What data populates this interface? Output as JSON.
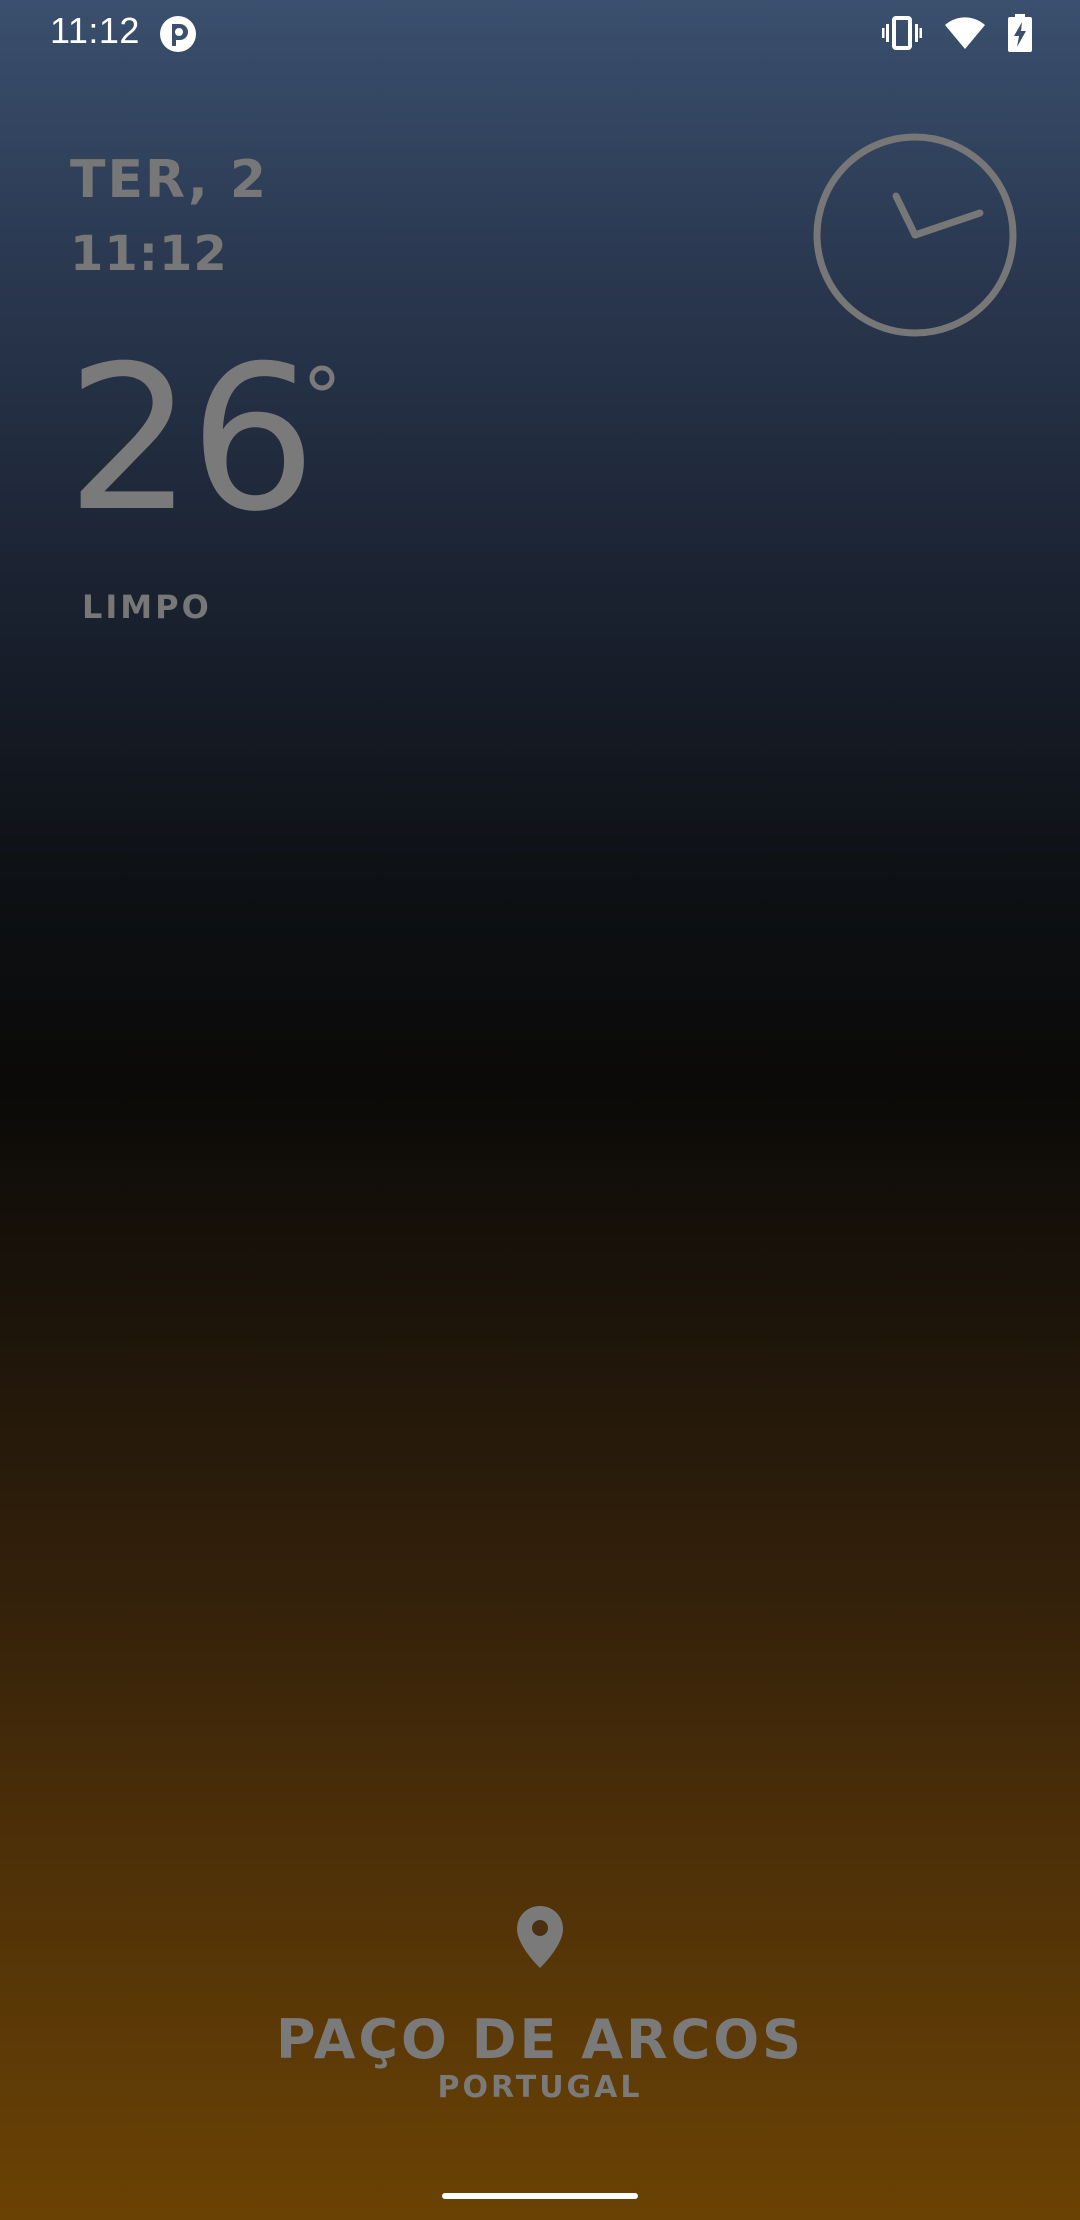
{
  "status_bar": {
    "time": "11:12",
    "app_icon": "app-notification-icon",
    "icons": [
      "vibrate-icon",
      "wifi-icon",
      "battery-charging-icon"
    ]
  },
  "widget": {
    "date": "TER, 2",
    "time": "11:12",
    "temperature": "26",
    "condition": "LIMPO",
    "clock_icon": "analog-clock-icon"
  },
  "location": {
    "pin_icon": "location-pin-icon",
    "city": "PAÇO DE ARCOS",
    "country": "PORTUGAL"
  },
  "colors": {
    "text": "#7a7a7a",
    "gradient_top": "#3a506e",
    "gradient_middle": "#0b0a08",
    "gradient_bottom": "#6a4204"
  }
}
